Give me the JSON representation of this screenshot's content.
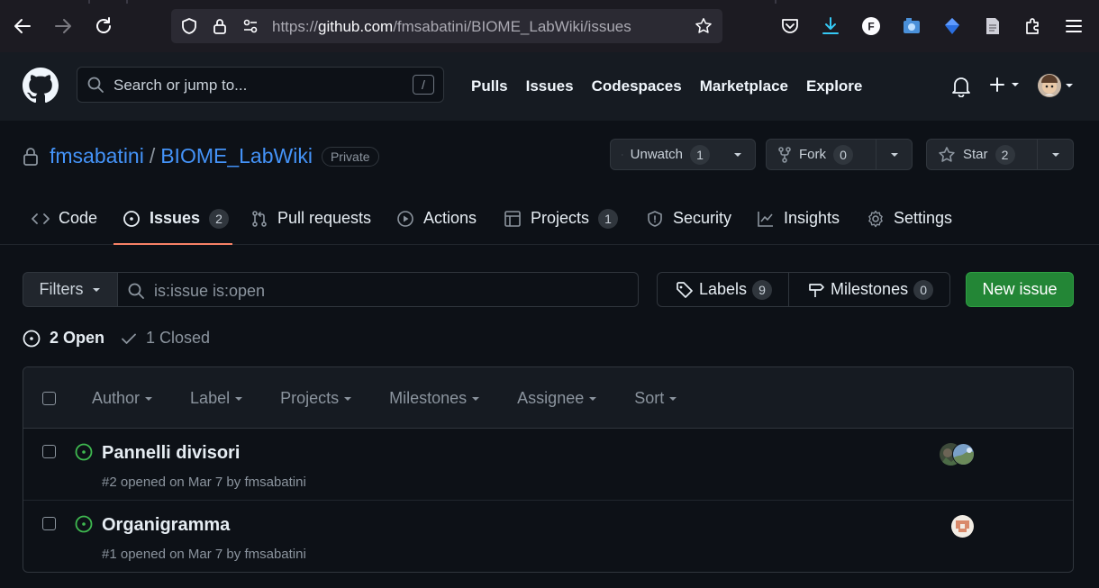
{
  "browser": {
    "url_prefix": "https://",
    "url_host": "github.com",
    "url_path": "/fmsabatini/BIOME_LabWiki/issues",
    "extension_letter": "F"
  },
  "header": {
    "search_placeholder": "Search or jump to...",
    "search_shortcut": "/",
    "nav": [
      "Pulls",
      "Issues",
      "Codespaces",
      "Marketplace",
      "Explore"
    ]
  },
  "repo": {
    "owner": "fmsabatini",
    "separator": "/",
    "name": "BIOME_LabWiki",
    "visibility": "Private",
    "watch": {
      "label": "Unwatch",
      "count": "1"
    },
    "fork": {
      "label": "Fork",
      "count": "0"
    },
    "star": {
      "label": "Star",
      "count": "2"
    }
  },
  "tabs": [
    {
      "label": "Code",
      "icon": "code-icon"
    },
    {
      "label": "Issues",
      "count": "2",
      "icon": "issue-opened-icon"
    },
    {
      "label": "Pull requests",
      "icon": "pull-request-icon"
    },
    {
      "label": "Actions",
      "icon": "play-icon"
    },
    {
      "label": "Projects",
      "count": "1",
      "icon": "table-icon"
    },
    {
      "label": "Security",
      "icon": "shield-icon"
    },
    {
      "label": "Insights",
      "icon": "graph-icon"
    },
    {
      "label": "Settings",
      "icon": "gear-icon"
    }
  ],
  "filters": {
    "button_label": "Filters",
    "query": "is:issue is:open",
    "labels": {
      "label": "Labels",
      "count": "9"
    },
    "milestones": {
      "label": "Milestones",
      "count": "0"
    },
    "new_issue_label": "New issue"
  },
  "states": {
    "open": "2 Open",
    "closed": "1 Closed"
  },
  "list_filters": [
    "Author",
    "Label",
    "Projects",
    "Milestones",
    "Assignee",
    "Sort"
  ],
  "issues": [
    {
      "title": "Pannelli divisori",
      "meta": "#2 opened on Mar 7 by fmsabatini"
    },
    {
      "title": "Organigramma",
      "meta": "#1 opened on Mar 7 by fmsabatini"
    }
  ],
  "colors": {
    "accent_link": "#4493f8",
    "open_green": "#3fb950",
    "primary_button": "#238636",
    "tab_underline": "#f78166"
  }
}
